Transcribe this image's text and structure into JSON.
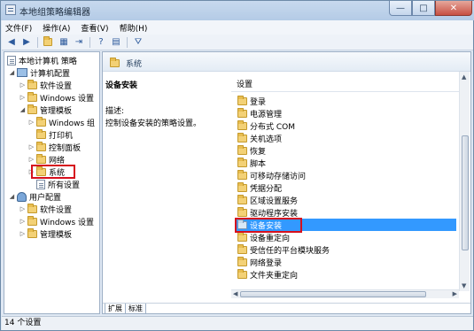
{
  "window": {
    "title": "本地组策略编辑器",
    "controls": [
      "—",
      "□",
      "✕"
    ]
  },
  "menu": {
    "items": [
      "文件(F)",
      "操作(A)",
      "查看(V)",
      "帮助(H)"
    ]
  },
  "toolbar": {
    "icons": [
      "back-arrow-icon",
      "forward-arrow-icon",
      "up-folder-icon",
      "show-hide-tree-icon",
      "export-list-icon",
      "help-icon",
      "properties-icon",
      "filter-icon"
    ]
  },
  "tree": {
    "root": "本地计算机 策略",
    "computer_config": "计算机配置",
    "software_settings": "软件设置",
    "windows_settings": "Windows 设置",
    "admin_templates": "管理模板",
    "windows_components": "Windows 组",
    "printers": "打印机",
    "control_panel": "控制面板",
    "network": "网络",
    "system": "系统",
    "all_settings": "所有设置",
    "user_config": "用户配置",
    "user_software_settings": "软件设置",
    "user_windows_settings": "Windows 设置",
    "user_admin_templates": "管理模板"
  },
  "main": {
    "header_title": "系统",
    "desc_heading": "设备安装",
    "desc_label": "描述:",
    "desc_text": "控制设备安装的策略设置。",
    "column_header": "设置",
    "items": [
      "登录",
      "电源管理",
      "分布式 COM",
      "关机选项",
      "恢复",
      "脚本",
      "可移动存储访问",
      "凭据分配",
      "区域设置服务",
      "驱动程序安装",
      "设备安装",
      "设备重定向",
      "受信任的平台模块服务",
      "网络登录",
      "文件夹重定向"
    ],
    "selected_item": "设备安装",
    "tabs": [
      "扩展",
      "标准"
    ]
  },
  "status": {
    "text": "14 个设置"
  },
  "colors": {
    "selection": "#3399ff",
    "highlight_box": "#d6101d",
    "folder": "#f3d176"
  }
}
